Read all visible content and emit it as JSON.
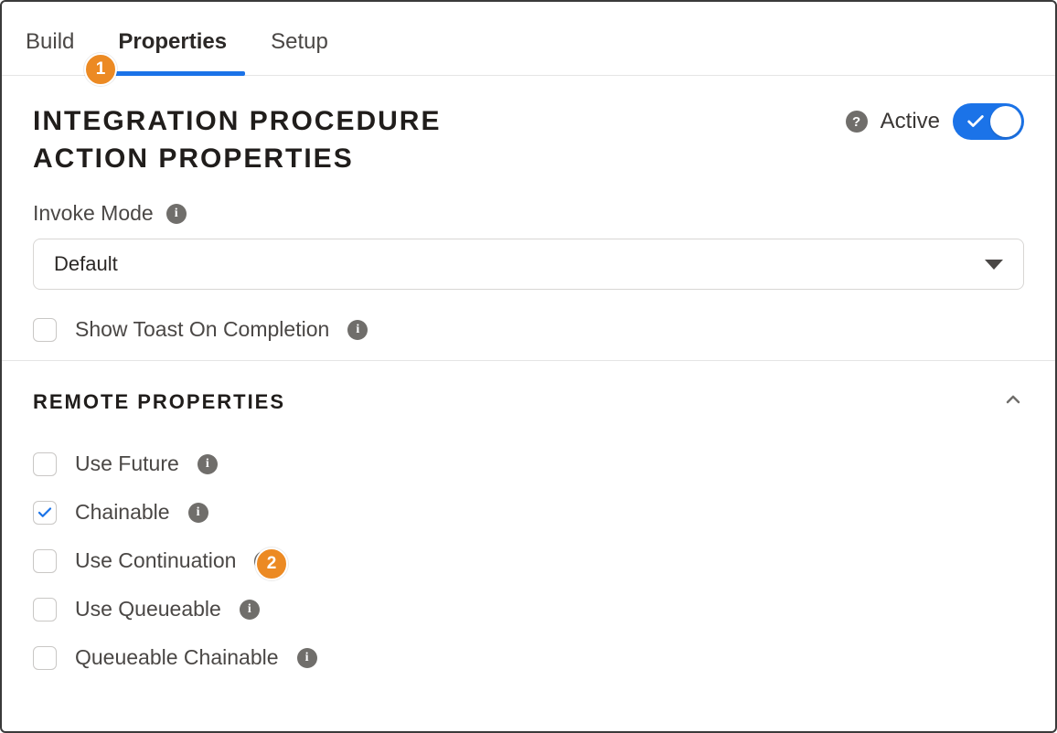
{
  "tabs": {
    "build": "Build",
    "properties": "Properties",
    "setup": "Setup",
    "active_index": 1
  },
  "header": {
    "title_line1": "INTEGRATION PROCEDURE",
    "title_line2": "ACTION PROPERTIES",
    "active_label": "Active",
    "active_toggle": true
  },
  "invoke_mode": {
    "label": "Invoke Mode",
    "selected": "Default"
  },
  "show_toast": {
    "label": "Show Toast On Completion",
    "checked": false
  },
  "remote_section": {
    "title": "REMOTE PROPERTIES",
    "expanded": true,
    "items": [
      {
        "label": "Use Future",
        "checked": false
      },
      {
        "label": "Chainable",
        "checked": true
      },
      {
        "label": "Use Continuation",
        "checked": false
      },
      {
        "label": "Use Queueable",
        "checked": false
      },
      {
        "label": "Queueable Chainable",
        "checked": false
      }
    ]
  },
  "callouts": {
    "c1": "1",
    "c2": "2"
  }
}
